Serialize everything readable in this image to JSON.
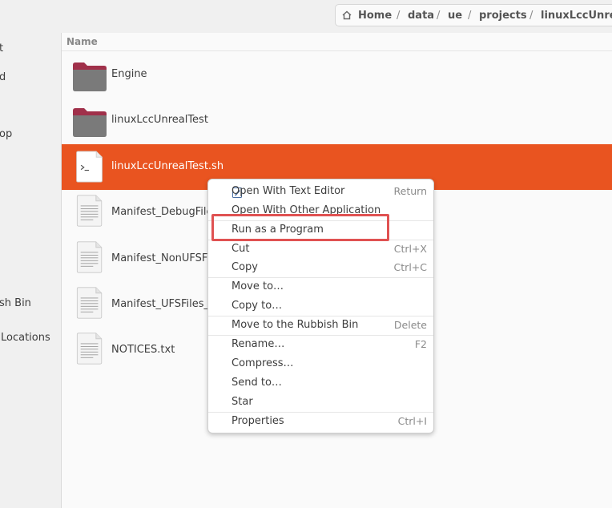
{
  "breadcrumb": {
    "home": "Home",
    "segments": [
      "data",
      "ue",
      "projects",
      "linuxLccUnrea"
    ]
  },
  "sidebar": {
    "items": [
      "t",
      "d",
      "op",
      "sh Bin",
      "Locations"
    ]
  },
  "file_list": {
    "column_header": "Name",
    "files": [
      {
        "name": "Engine",
        "type": "folder"
      },
      {
        "name": "linuxLccUnrealTest",
        "type": "folder"
      },
      {
        "name": "linuxLccUnrealTest.sh",
        "type": "script",
        "selected": true
      },
      {
        "name": "Manifest_DebugFile",
        "type": "text"
      },
      {
        "name": "Manifest_NonUFSFi",
        "type": "text"
      },
      {
        "name": "Manifest_UFSFiles_",
        "type": "text"
      },
      {
        "name": "NOTICES.txt",
        "type": "text"
      }
    ]
  },
  "context_menu": {
    "items": [
      {
        "label": "Open With Text Editor",
        "shortcut": "Return"
      },
      {
        "label": "Open With Other Application",
        "shortcut": ""
      },
      {
        "label": "Run as a Program",
        "shortcut": ""
      },
      {
        "label": "Cut",
        "shortcut": "Ctrl+X"
      },
      {
        "label": "Copy",
        "shortcut": "Ctrl+C"
      },
      {
        "label": "Move to…",
        "shortcut": ""
      },
      {
        "label": "Copy to…",
        "shortcut": ""
      },
      {
        "label": "Move to the Rubbish Bin",
        "shortcut": "Delete"
      },
      {
        "label": "Rename…",
        "shortcut": "F2"
      },
      {
        "label": "Compress…",
        "shortcut": ""
      },
      {
        "label": "Send to…",
        "shortcut": ""
      },
      {
        "label": "Star",
        "shortcut": ""
      },
      {
        "label": "Properties",
        "shortcut": "Ctrl+I"
      }
    ]
  },
  "colors": {
    "selection": "#e95420",
    "highlight_box": "#e05252",
    "folder": "#7a7a7a",
    "folder_tab": "#a0304a"
  },
  "icons": {
    "home": "home-icon",
    "folder": "folder-icon",
    "script": "terminal-script-icon",
    "text": "text-file-icon",
    "editor": "text-editor-icon"
  }
}
